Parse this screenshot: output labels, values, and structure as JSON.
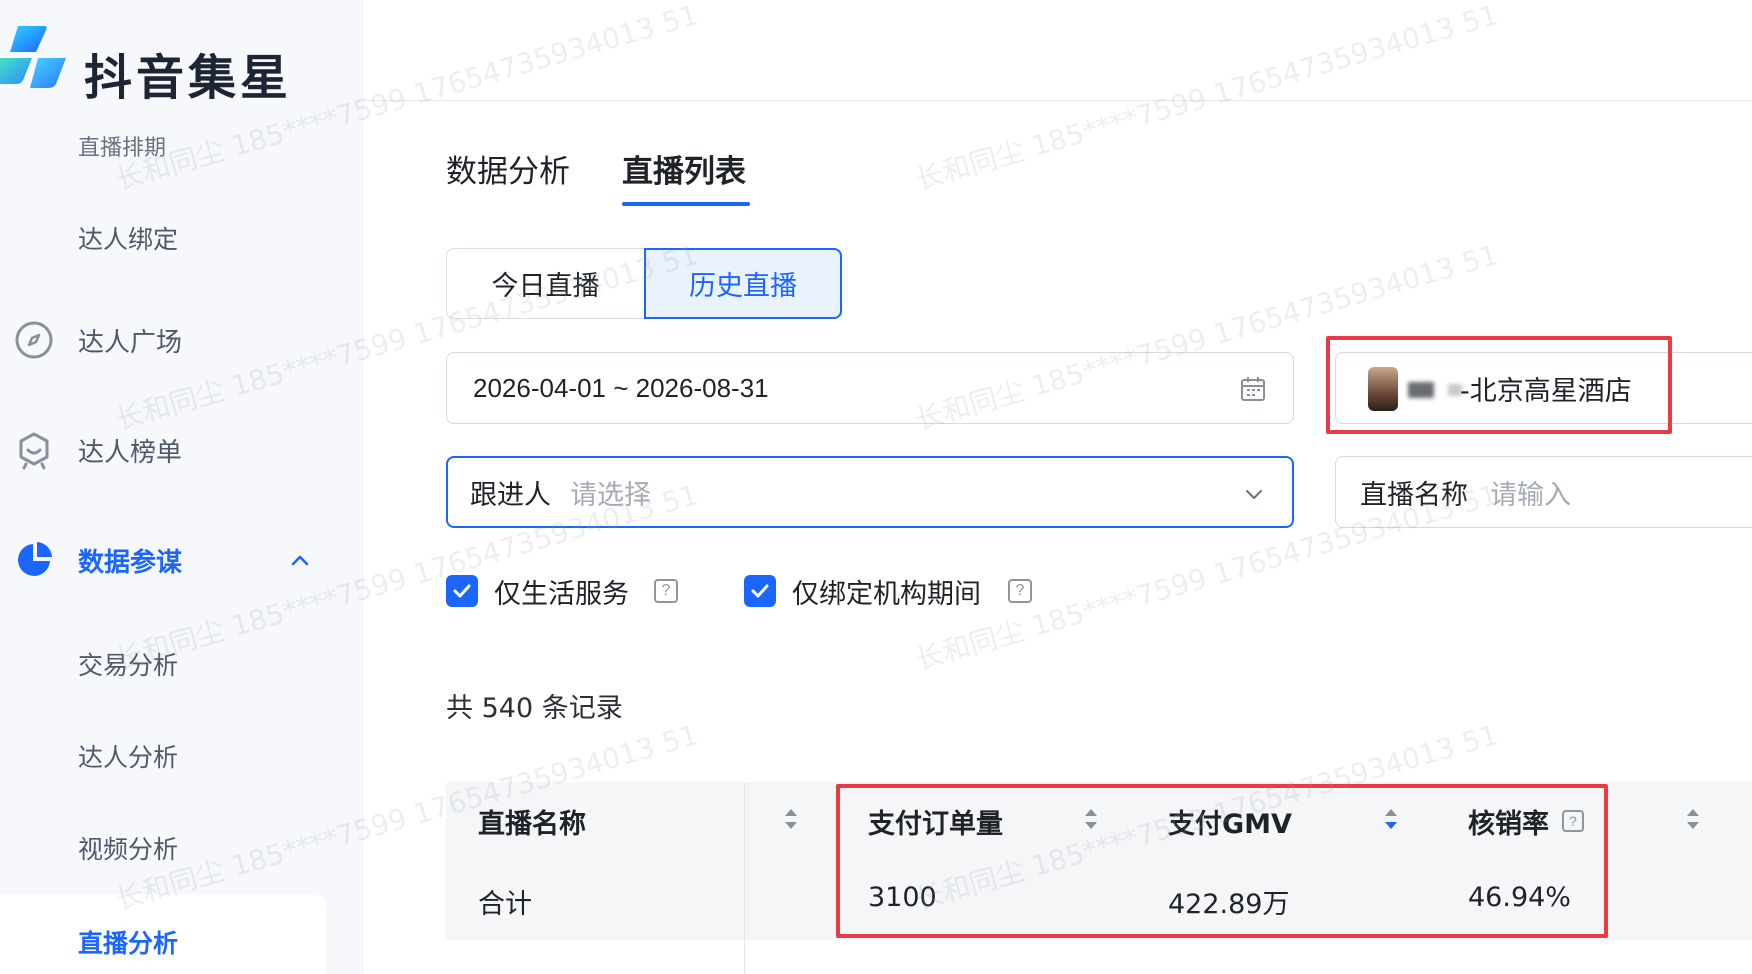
{
  "brand": {
    "name": "抖音集星"
  },
  "sidebar": {
    "items": [
      {
        "label": "直播排期"
      },
      {
        "label": "达人绑定"
      },
      {
        "label": "达人广场",
        "icon": "compass-icon"
      },
      {
        "label": "达人榜单",
        "icon": "ranking-badge-icon"
      },
      {
        "label": "数据参谋",
        "icon": "pie-chart-icon",
        "expanded": true
      },
      {
        "label": "交易分析"
      },
      {
        "label": "达人分析"
      },
      {
        "label": "视频分析"
      },
      {
        "label": "直播分析",
        "active": true
      }
    ]
  },
  "tabs": [
    {
      "label": "数据分析"
    },
    {
      "label": "直播列表",
      "active": true
    }
  ],
  "segment": {
    "today": "今日直播",
    "history": "历史直播",
    "selected": "history"
  },
  "filters": {
    "date_range": "2026-04-01 ~ 2026-08-31",
    "store": "-北京高星酒店",
    "follower_label": "跟进人",
    "follower_placeholder": "请选择",
    "live_name_label": "直播名称",
    "live_name_placeholder": "请输入"
  },
  "checkboxes": [
    {
      "label": "仅生活服务",
      "checked": true,
      "help": "?"
    },
    {
      "label": "仅绑定机构期间",
      "checked": true,
      "help": "?"
    }
  ],
  "record_count": "共 540 条记录",
  "table": {
    "headers": [
      "直播名称",
      "支付订单量",
      "支付GMV",
      "核销率"
    ],
    "help_mark": "?",
    "summary": {
      "label": "合计",
      "orders": "3100",
      "gmv": "422.89万",
      "redeem_rate": "46.94%"
    }
  },
  "watermark": "长和同尘 185****7599 17654735934013 51",
  "colors": {
    "accent": "#1a66ff",
    "highlight": "#ea3a45"
  }
}
